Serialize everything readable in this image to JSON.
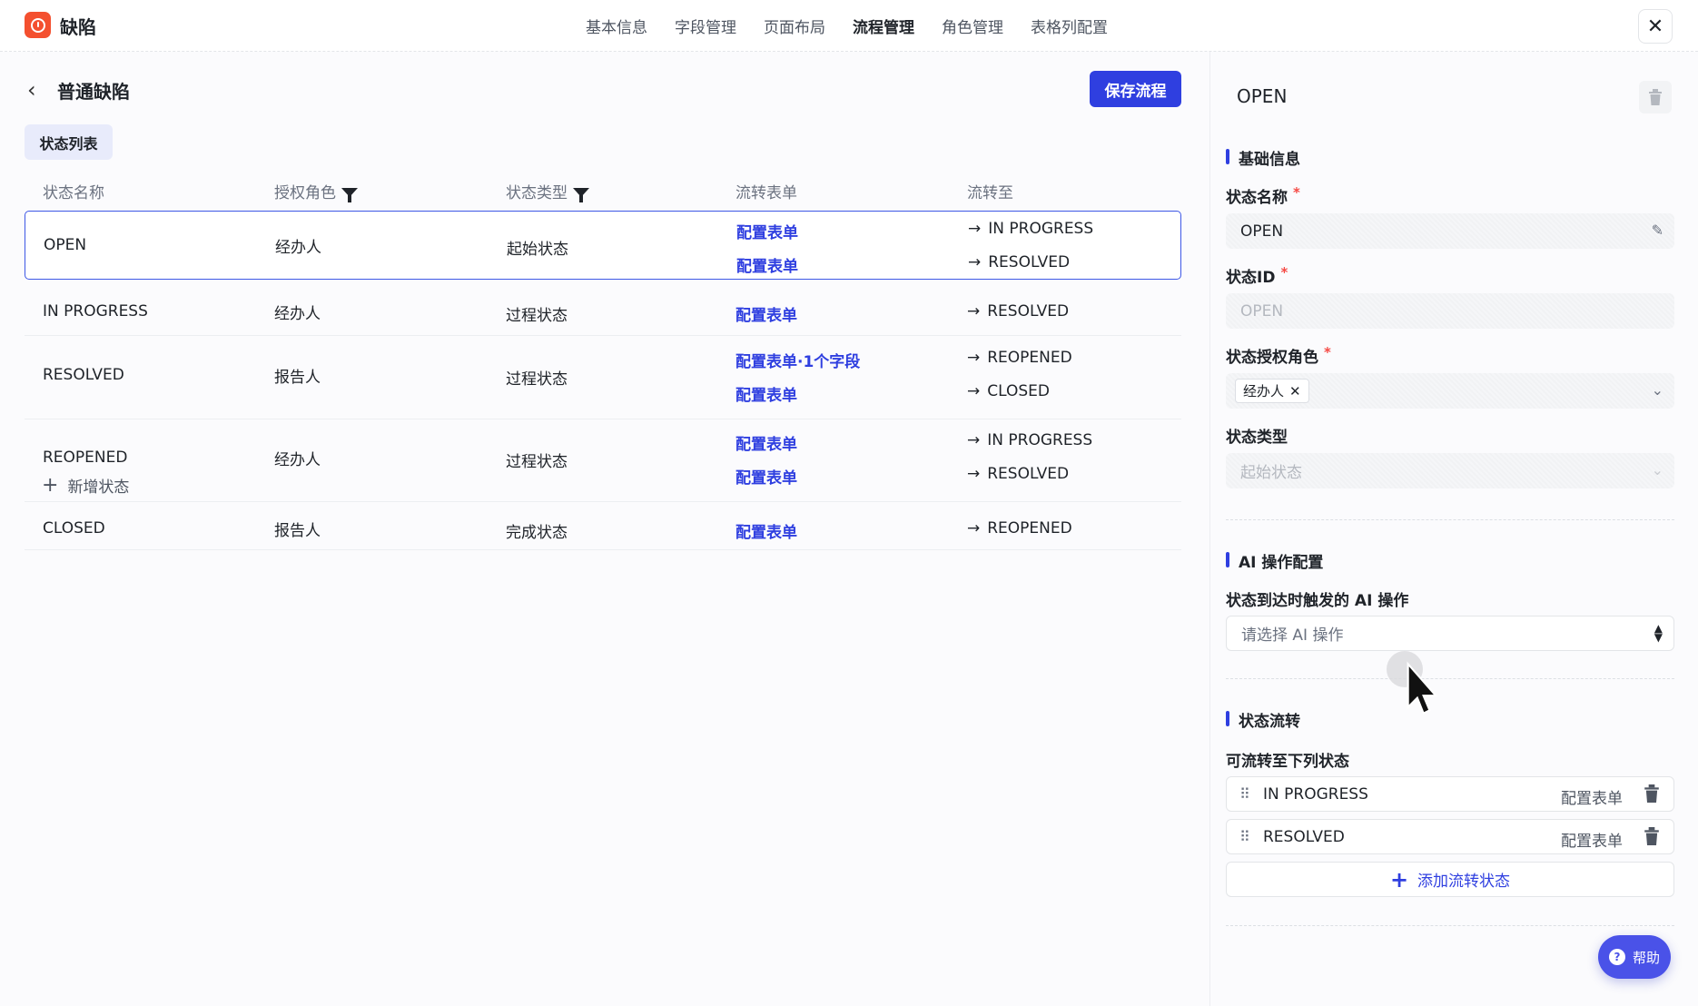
{
  "app": {
    "title": "缺陷",
    "close_icon": "close-icon"
  },
  "nav": [
    "基本信息",
    "字段管理",
    "页面布局",
    "流程管理",
    "角色管理",
    "表格列配置"
  ],
  "nav_active": "流程管理",
  "page": {
    "title": "普通缺陷",
    "save_label": "保存流程",
    "tab_label": "状态列表",
    "add_state_label": "新增状态"
  },
  "columns": [
    "状态名称",
    "授权角色",
    "状态类型",
    "流转表单",
    "流转至"
  ],
  "rows": [
    {
      "name": "OPEN",
      "role": "经办人",
      "type": "起始状态",
      "transitions": [
        {
          "form": "配置表单",
          "to": "IN PROGRESS"
        },
        {
          "form": "配置表单",
          "to": "RESOLVED"
        }
      ]
    },
    {
      "name": "IN PROGRESS",
      "role": "经办人",
      "type": "过程状态",
      "transitions": [
        {
          "form": "配置表单",
          "to": "RESOLVED"
        }
      ]
    },
    {
      "name": "RESOLVED",
      "role": "报告人",
      "type": "过程状态",
      "transitions": [
        {
          "form": "配置表单·1个字段",
          "to": "REOPENED"
        },
        {
          "form": "配置表单",
          "to": "CLOSED"
        }
      ]
    },
    {
      "name": "REOPENED",
      "role": "经办人",
      "type": "过程状态",
      "transitions": [
        {
          "form": "配置表单",
          "to": "IN PROGRESS"
        },
        {
          "form": "配置表单",
          "to": "RESOLVED"
        }
      ]
    },
    {
      "name": "CLOSED",
      "role": "报告人",
      "type": "完成状态",
      "transitions": [
        {
          "form": "配置表单",
          "to": "REOPENED"
        }
      ]
    }
  ],
  "side": {
    "title": "OPEN",
    "basic_section": "基础信息",
    "name_label": "状态名称",
    "name_value": "OPEN",
    "id_label": "状态ID",
    "id_value": "OPEN",
    "role_label": "状态授权角色",
    "role_chip": "经办人",
    "type_label": "状态类型",
    "type_value": "起始状态",
    "ai_section": "AI 操作配置",
    "ai_label": "状态到达时触发的 AI 操作",
    "ai_placeholder": "请选择 AI 操作",
    "flow_section": "状态流转",
    "flow_label": "可流转至下列状态",
    "flows": [
      {
        "name": "IN PROGRESS",
        "form": "配置表单"
      },
      {
        "name": "RESOLVED",
        "form": "配置表单"
      }
    ],
    "add_flow_label": "添加流转状态",
    "required_mark": "*"
  },
  "help": {
    "label": "帮助"
  },
  "colors": {
    "accent": "#2f3fe0",
    "brand": "#f4502f",
    "selected_border": "#3d57e6"
  }
}
